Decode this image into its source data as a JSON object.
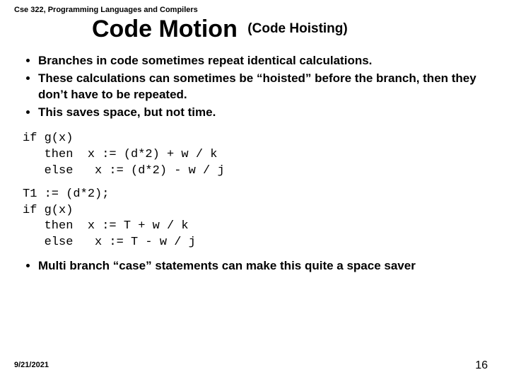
{
  "course": "Cse 322, Programming Languages and Compilers",
  "title": {
    "main": "Code Motion",
    "sub": "(Code Hoisting)"
  },
  "bullets_top": [
    "Branches in code sometimes repeat identical calculations.",
    "These calculations can sometimes be “hoisted” before the branch, then they don’t have to be repeated.",
    "This saves space, but not time."
  ],
  "code1": "if g(x)\n   then  x := (d*2) + w / k\n   else   x := (d*2) - w / j",
  "code2": "T1 := (d*2);\nif g(x)\n   then  x := T + w / k\n   else   x := T - w / j",
  "bullets_bottom": [
    "Multi branch “case” statements can make this quite a space saver"
  ],
  "footer": {
    "date": "9/21/2021",
    "page": "16"
  }
}
